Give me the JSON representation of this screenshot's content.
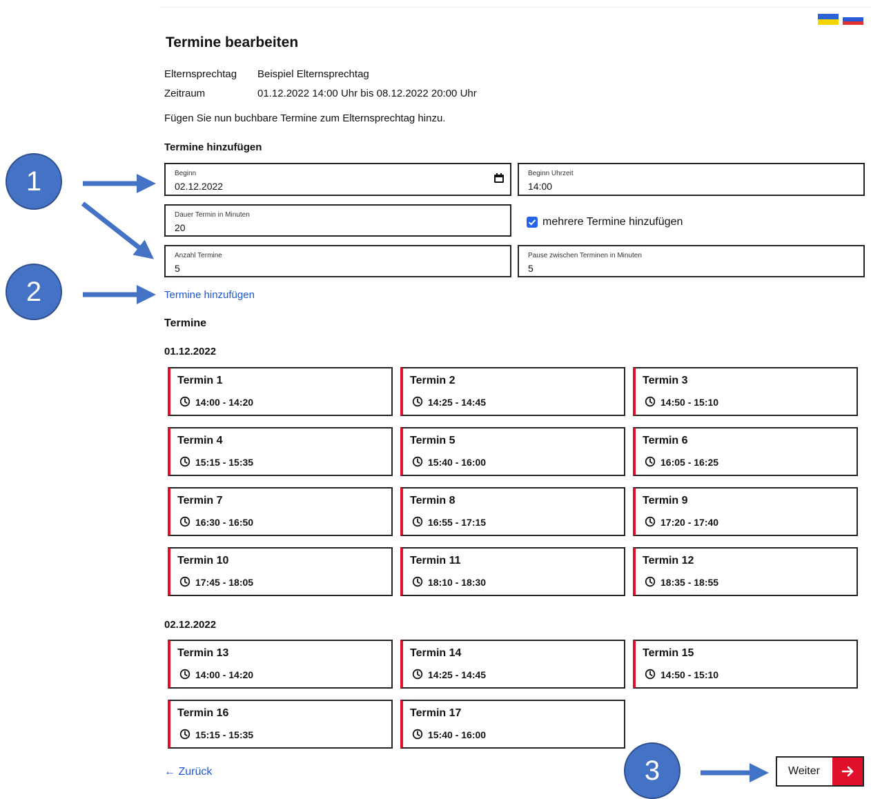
{
  "page": {
    "title": "Termine bearbeiten",
    "info": {
      "event_label": "Elternsprechtag",
      "event_value": "Beispiel Elternsprechtag",
      "period_label": "Zeitraum",
      "period_value": "01.12.2022 14:00 Uhr bis 08.12.2022 20:00 Uhr"
    },
    "intro": "Fügen Sie nun buchbare Termine zum Elternsprechtag hinzu."
  },
  "form": {
    "section_title": "Termine hinzufügen",
    "begin_label": "Beginn",
    "begin_value": "02.12.2022",
    "begin_time_label": "Beginn Uhrzeit",
    "begin_time_value": "14:00",
    "duration_label": "Dauer Termin in Minuten",
    "duration_value": "20",
    "multiple_label": "mehrere Termine hinzufügen",
    "count_label": "Anzahl Termine",
    "count_value": "5",
    "pause_label": "Pause zwischen Terminen in Minuten",
    "pause_value": "5",
    "add_link": "Termine hinzufügen"
  },
  "appointments": {
    "title": "Termine",
    "groups": [
      {
        "date": "01.12.2022",
        "items": [
          {
            "name": "Termin 1",
            "time": "14:00 - 14:20"
          },
          {
            "name": "Termin 2",
            "time": "14:25 - 14:45"
          },
          {
            "name": "Termin 3",
            "time": "14:50 - 15:10"
          },
          {
            "name": "Termin 4",
            "time": "15:15 - 15:35"
          },
          {
            "name": "Termin 5",
            "time": "15:40 - 16:00"
          },
          {
            "name": "Termin 6",
            "time": "16:05 - 16:25"
          },
          {
            "name": "Termin 7",
            "time": "16:30 - 16:50"
          },
          {
            "name": "Termin 8",
            "time": "16:55 - 17:15"
          },
          {
            "name": "Termin 9",
            "time": "17:20 - 17:40"
          },
          {
            "name": "Termin 10",
            "time": "17:45 - 18:05"
          },
          {
            "name": "Termin 11",
            "time": "18:10 - 18:30"
          },
          {
            "name": "Termin 12",
            "time": "18:35 - 18:55"
          }
        ]
      },
      {
        "date": "02.12.2022",
        "items": [
          {
            "name": "Termin 13",
            "time": "14:00 - 14:20"
          },
          {
            "name": "Termin 14",
            "time": "14:25 - 14:45"
          },
          {
            "name": "Termin 15",
            "time": "14:50 - 15:10"
          },
          {
            "name": "Termin 16",
            "time": "15:15 - 15:35"
          },
          {
            "name": "Termin 17",
            "time": "15:40 - 16:00"
          }
        ]
      }
    ]
  },
  "nav": {
    "back": "← Zurück",
    "next": "Weiter"
  },
  "annotations": {
    "step1": "1",
    "step2": "2",
    "step3": "3"
  },
  "colors": {
    "accent_red": "#e0102a",
    "link_blue": "#1a56db",
    "annotation_blue": "#4472c4"
  },
  "icons": {
    "calendar": "calendar-icon",
    "clock": "clock-icon",
    "arrow_right": "arrow-right-icon"
  }
}
